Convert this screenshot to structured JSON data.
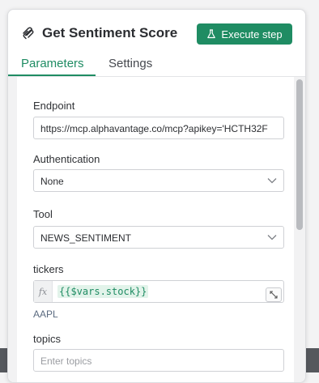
{
  "header": {
    "title": "Get Sentiment Score",
    "execute_label": "Execute step"
  },
  "tabs": [
    {
      "label": "Parameters",
      "active": true
    },
    {
      "label": "Settings",
      "active": false
    }
  ],
  "form": {
    "endpoint": {
      "label": "Endpoint",
      "value": "https://mcp.alphavantage.co/mcp?apikey='HCTH32F"
    },
    "authentication": {
      "label": "Authentication",
      "value": "None"
    },
    "tool": {
      "label": "Tool",
      "value": "NEWS_SENTIMENT"
    },
    "tickers": {
      "label": "tickers",
      "fx": "fx",
      "expression": "{{$vars.stock}}",
      "resolved": "AAPL"
    },
    "topics": {
      "label": "topics",
      "placeholder": "Enter topics"
    }
  },
  "colors": {
    "accent": "#1f8c63",
    "expression_bg": "#e2f3ea"
  }
}
